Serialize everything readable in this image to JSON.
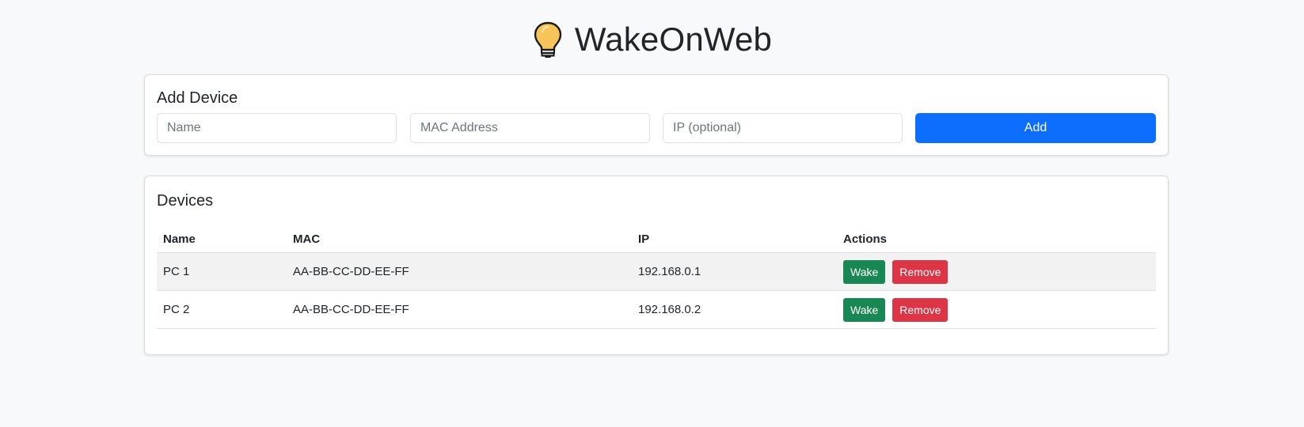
{
  "app": {
    "title": "WakeOnWeb",
    "icon": "lightbulb-icon"
  },
  "add_device": {
    "title": "Add Device",
    "name_placeholder": "Name",
    "mac_placeholder": "MAC Address",
    "ip_placeholder": "IP (optional)",
    "name_value": "",
    "mac_value": "",
    "ip_value": "",
    "add_label": "Add"
  },
  "devices": {
    "title": "Devices",
    "columns": [
      "Name",
      "MAC",
      "IP",
      "Actions"
    ],
    "rows": [
      {
        "name": "PC 1",
        "mac": "AA-BB-CC-DD-EE-FF",
        "ip": "192.168.0.1",
        "wake_label": "Wake",
        "remove_label": "Remove"
      },
      {
        "name": "PC 2",
        "mac": "AA-BB-CC-DD-EE-FF",
        "ip": "192.168.0.2",
        "wake_label": "Wake",
        "remove_label": "Remove"
      }
    ]
  },
  "colors": {
    "primary": "#0d6efd",
    "success": "#198754",
    "danger": "#dc3545",
    "background": "#f8f9fa"
  }
}
